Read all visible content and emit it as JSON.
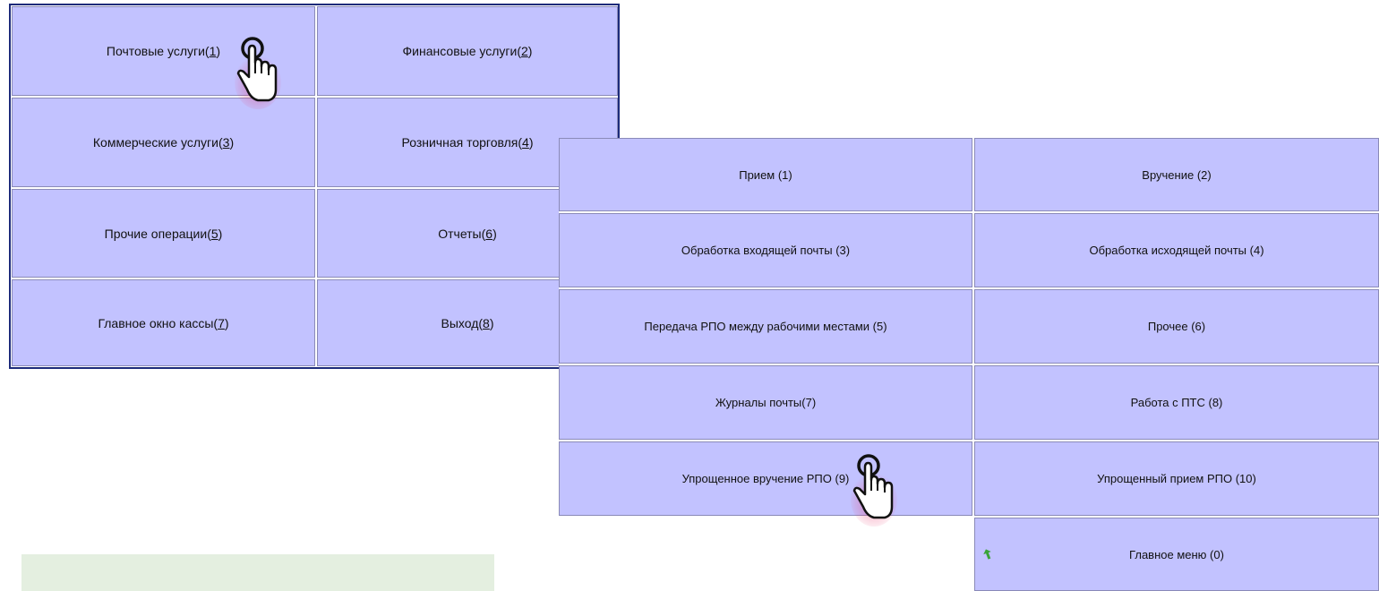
{
  "main_menu": {
    "buttons": [
      {
        "label": "Почтовые услуги ",
        "key": "1",
        "close": ""
      },
      {
        "label": "Финансовые услуги ",
        "key": "2",
        "close": ""
      },
      {
        "label": "Коммерческие услуги ",
        "key": "3",
        "close": ""
      },
      {
        "label": "Розничная торговля ",
        "key": "4",
        "close": ""
      },
      {
        "label": "Прочие операции ",
        "key": "5",
        "close": ""
      },
      {
        "label": "Отчеты ",
        "key": "6",
        "close": ""
      },
      {
        "label": "Главное окно кассы ",
        "key": "7",
        "close": ""
      },
      {
        "label": "Выход ",
        "key": "8",
        "close": ""
      }
    ]
  },
  "postal_menu": {
    "buttons": [
      {
        "label": "Прием (1)"
      },
      {
        "label": "Вручение (2)"
      },
      {
        "label": "Обработка входящей почты (3)"
      },
      {
        "label": "Обработка исходящей почты (4)"
      },
      {
        "label": "Передача РПО между рабочими местами (5)"
      },
      {
        "label": "Прочее (6)"
      },
      {
        "label": "Журналы почты(7)"
      },
      {
        "label": "Работа с ПТС (8)"
      },
      {
        "label": "Упрощенное вручение РПО (9)"
      },
      {
        "label": "Упрощенный прием РПО (10)"
      },
      {
        "label": "Главное меню (0)"
      }
    ]
  },
  "status_bar": {
    "text": ""
  },
  "icons": {
    "cursor": "hand-pointer-icon",
    "back": "back-arrow-icon"
  },
  "colors": {
    "button_bg": "#c2c2ff",
    "panel_border": "#1c2a7a",
    "status_bg": "#e4efe0",
    "back_arrow": "#3aa33a"
  }
}
